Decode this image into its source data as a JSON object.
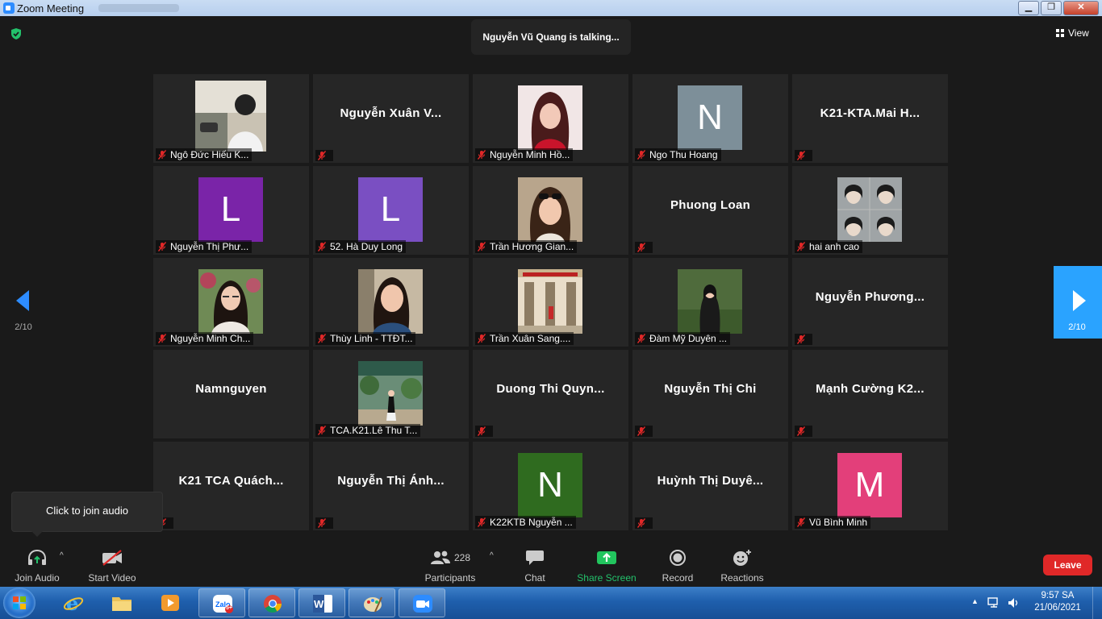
{
  "window": {
    "title": "Zoom Meeting",
    "buttons": [
      "minimize",
      "restore",
      "close"
    ]
  },
  "header": {
    "talking": "Nguyễn Vũ Quang is talking...",
    "view_label": "View"
  },
  "pagination": {
    "left": "2/10",
    "right": "2/10"
  },
  "participants": [
    {
      "name": "Ngô Đức Hiếu K...",
      "kind": "photo",
      "photo": "photo-boy-street"
    },
    {
      "name": "Nguyễn Xuân V...",
      "kind": "name"
    },
    {
      "name": "Nguyễn Minh Hồ...",
      "kind": "photo",
      "photo": "photo-woman-red"
    },
    {
      "name": "Ngo Thu Hoang",
      "kind": "avatar",
      "initial": "N",
      "color": "#7d8f99"
    },
    {
      "name": "K21-KTA.Mai H...",
      "kind": "name"
    },
    {
      "name": "Nguyễn Thị  Phư...",
      "kind": "avatar",
      "initial": "L",
      "color": "#7a24a8"
    },
    {
      "name": "52. Hà Duy Long",
      "kind": "avatar",
      "initial": "L",
      "color": "#7a4fc2"
    },
    {
      "name": "Trần Hương Gian...",
      "kind": "photo",
      "photo": "photo-girl-sunglasses"
    },
    {
      "name": "Phuong Loan",
      "kind": "name"
    },
    {
      "name": "hai anh cao",
      "kind": "photo",
      "photo": "photo-collage"
    },
    {
      "name": "Nguyễn Minh Ch...",
      "kind": "photo",
      "photo": "photo-girl-glasses"
    },
    {
      "name": "Thùy Linh - TTĐT...",
      "kind": "photo",
      "photo": "photo-girl-smile"
    },
    {
      "name": "Trần Xuân Sang....",
      "kind": "photo",
      "photo": "photo-building"
    },
    {
      "name": "Đàm Mỹ Duyên ...",
      "kind": "photo",
      "photo": "photo-girl-forest"
    },
    {
      "name": "Nguyễn  Phương...",
      "kind": "name"
    },
    {
      "name": "Namnguyen",
      "kind": "name",
      "hide_label": true
    },
    {
      "name": "TCA.K21.Lê Thu T...",
      "kind": "photo",
      "photo": "photo-garden"
    },
    {
      "name": "Duong  Thi  Quyn...",
      "kind": "name"
    },
    {
      "name": "Nguyễn Thị Chi",
      "kind": "name"
    },
    {
      "name": "Mạnh Cường  K2...",
      "kind": "name"
    },
    {
      "name": "K21 TCA Quách...",
      "kind": "name"
    },
    {
      "name": "Nguyễn Thị Ánh...",
      "kind": "name"
    },
    {
      "name": "K22KTB Nguyễn ...",
      "kind": "avatar",
      "initial": "N",
      "color": "#2f6b1f"
    },
    {
      "name": "Huỳnh Thị Duyê...",
      "kind": "name"
    },
    {
      "name": "Vũ Bình Minh",
      "kind": "avatar",
      "initial": "M",
      "color": "#e33f7a"
    }
  ],
  "tooltip": "Click to join audio",
  "toolbar": {
    "join_audio": "Join Audio",
    "start_video": "Start Video",
    "participants_count": "228",
    "participants": "Participants",
    "chat": "Chat",
    "share_screen": "Share Screen",
    "record": "Record",
    "reactions": "Reactions",
    "leave": "Leave"
  },
  "taskbar": {
    "apps": [
      "internet-explorer",
      "file-explorer",
      "media-player",
      "zalo",
      "chrome",
      "word",
      "paint",
      "zoom"
    ],
    "zalo_badge": "5+",
    "time": "9:57 SA",
    "date": "21/06/2021"
  },
  "colors": {
    "accent": "#2d8cff",
    "leave": "#e02828",
    "share": "#22c55e",
    "tile": "#262626",
    "mic_off": "#e02828"
  }
}
